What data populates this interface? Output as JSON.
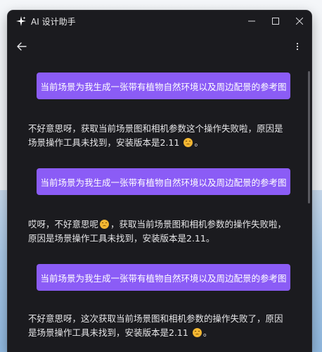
{
  "window": {
    "title": "AI 设计助手",
    "accent": "#8b5cf6",
    "background": "#1b1b1f"
  },
  "messages": [
    {
      "role": "user",
      "text": "当前场景为我生成一张带有植物自然环境以及周边配景的参考图"
    },
    {
      "role": "assistant",
      "lines": [
        "不好意思呀，获取当前场景图和相机参数这个操作失败啦，原因是",
        "场景操作工具未找到，安装版本是2.11",
        "。"
      ]
    },
    {
      "role": "user",
      "text": "当前场景为我生成一张带有植物自然环境以及周边配景的参考图"
    },
    {
      "role": "assistant",
      "lines": [
        "哎呀，不好意思呢",
        "，获取当前场景图和相机参数的操作失败啦，",
        "原因是场景操作工具未找到，安装版本是2.11。"
      ]
    },
    {
      "role": "user",
      "text": "当前场景为我生成一张带有植物自然环境以及周边配景的参考图"
    },
    {
      "role": "assistant",
      "lines": [
        "不好意思呀，这次获取当前场景图和相机参数的操作失败了，原因",
        "是场景操作工具未找到，安装版本是2.11",
        "。"
      ]
    }
  ],
  "icons": {
    "app": "sparkle-icon",
    "back": "arrow-left-icon",
    "more": "more-vertical-icon",
    "emoji": "disappointed-face-icon"
  }
}
